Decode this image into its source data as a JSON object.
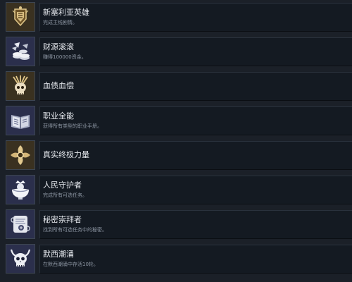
{
  "achievements": [
    {
      "title": "新塞利亚英雄",
      "description": "完成主线剧情。",
      "icon": "shield-crest-icon",
      "tile_color": "gold"
    },
    {
      "title": "财源滚滚",
      "description": "赚得100000资金。",
      "icon": "coin-pile-icon",
      "tile_color": "blue"
    },
    {
      "title": "血债血偿",
      "description": "",
      "icon": "feathered-skull-icon",
      "tile_color": "gold"
    },
    {
      "title": "职业全能",
      "description": "获得所有类型的职业手册。",
      "icon": "open-book-icon",
      "tile_color": "blue"
    },
    {
      "title": "真实终极力量",
      "description": "",
      "icon": "spiral-shuriken-icon",
      "tile_color": "gold"
    },
    {
      "title": "人民守护者",
      "description": "完成所有可选任务。",
      "icon": "crowned-bowl-icon",
      "tile_color": "blue"
    },
    {
      "title": "秘密崇拜者",
      "description": "找到所有可选任务中的秘密。",
      "icon": "scroll-seal-icon",
      "tile_color": "blue"
    },
    {
      "title": "默西潮涌",
      "description": "在默西潮涌中存活10轮。",
      "icon": "horned-skull-icon",
      "tile_color": "blue"
    }
  ]
}
